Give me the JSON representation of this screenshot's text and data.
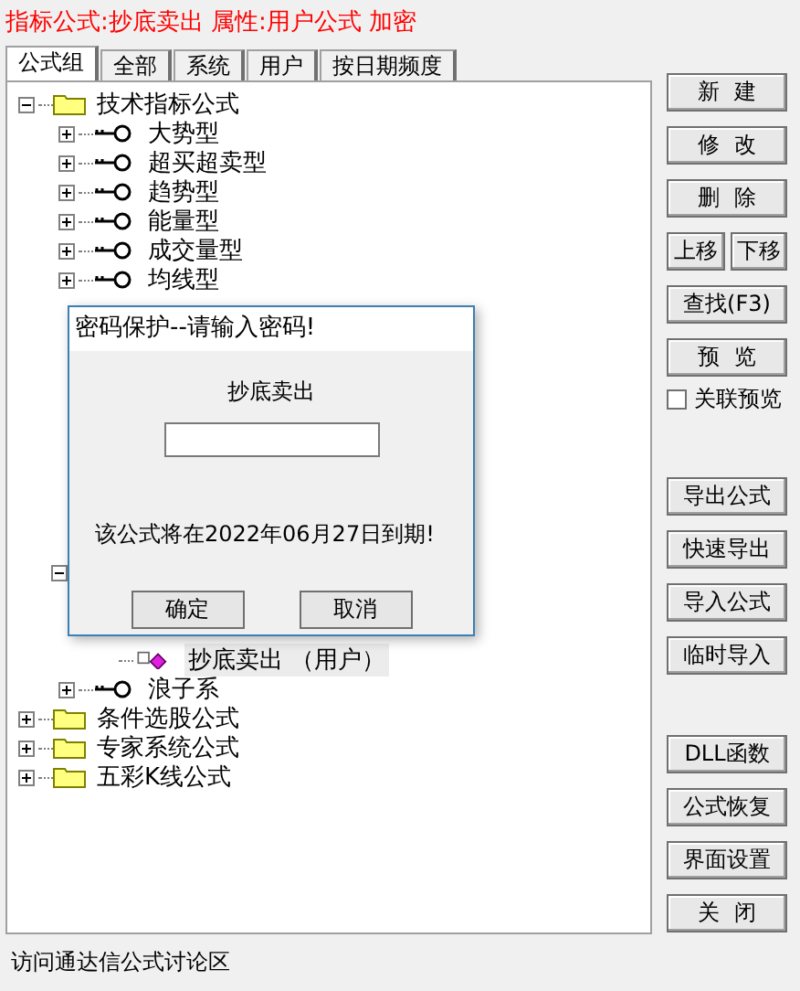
{
  "header": "指标公式:抄底卖出 属性:用户公式 加密",
  "tabs": [
    {
      "label": "公式组",
      "selected": true
    },
    {
      "label": "全部",
      "selected": false
    },
    {
      "label": "系统",
      "selected": false
    },
    {
      "label": "用户",
      "selected": false
    },
    {
      "label": "按日期频度",
      "selected": false
    }
  ],
  "tree": [
    {
      "label": "技术指标公式",
      "kind": "folder",
      "expanded": true,
      "children": [
        {
          "label": "大势型",
          "kind": "key",
          "expanded": false
        },
        {
          "label": "超买超卖型",
          "kind": "key",
          "expanded": false
        },
        {
          "label": "趋势型",
          "kind": "key",
          "expanded": false
        },
        {
          "label": "能量型",
          "kind": "key",
          "expanded": false
        },
        {
          "label": "成交量型",
          "kind": "key",
          "expanded": false
        },
        {
          "label": "均线型",
          "kind": "key",
          "expanded": false
        },
        {
          "kind": "obscured",
          "expanded": true,
          "children": [
            {
              "label": "抄底卖出 （用户）",
              "kind": "formula",
              "selected": true
            }
          ]
        },
        {
          "label": "浪子系",
          "kind": "key",
          "expanded": false
        }
      ]
    },
    {
      "label": "条件选股公式",
      "kind": "folder",
      "expanded": false
    },
    {
      "label": "专家系统公式",
      "kind": "folder",
      "expanded": false
    },
    {
      "label": "五彩K线公式",
      "kind": "folder",
      "expanded": false
    }
  ],
  "buttons": [
    {
      "label": "新  建",
      "kind": "button"
    },
    {
      "label": "修  改",
      "kind": "button"
    },
    {
      "label": "删  除",
      "kind": "button"
    },
    {
      "kind": "pair",
      "items": [
        "上移",
        "下移"
      ]
    },
    {
      "label": "查找(F3)",
      "kind": "button"
    },
    {
      "label": "预  览",
      "kind": "button"
    },
    {
      "label": "关联预览",
      "kind": "checkbox",
      "checked": false
    },
    {
      "kind": "gap"
    },
    {
      "label": "导出公式",
      "kind": "button"
    },
    {
      "label": "快速导出",
      "kind": "button"
    },
    {
      "label": "导入公式",
      "kind": "button"
    },
    {
      "label": "临时导入",
      "kind": "button"
    },
    {
      "kind": "gap"
    },
    {
      "label": "DLL函数",
      "kind": "button"
    },
    {
      "label": "公式恢复",
      "kind": "button"
    },
    {
      "label": "界面设置",
      "kind": "button"
    },
    {
      "label": "关  闭",
      "kind": "button"
    }
  ],
  "status_bar": "访问通达信公式讨论区",
  "dialog": {
    "title": "密码保护--请输入密码!",
    "formula_name": "抄底卖出",
    "message": "该公式将在2022年06月27日到期!",
    "buttons": [
      "确定",
      "取消"
    ]
  }
}
